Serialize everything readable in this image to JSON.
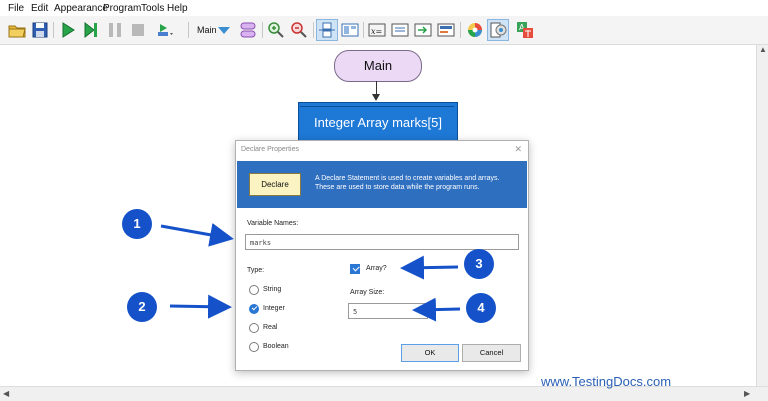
{
  "menu": [
    "File",
    "Edit",
    "Appearance",
    "Program",
    "Tools",
    "Help"
  ],
  "toolbar": {
    "function_label": "Main",
    "icons": [
      "open-folder-icon",
      "save-icon",
      "run-icon",
      "step-icon",
      "pause-icon",
      "stop-icon",
      "speed-icon",
      "dropdown-icon",
      "function-icon",
      "zoom-in-icon",
      "zoom-out-icon",
      "variables-icon",
      "watch-icon",
      "declare-icon",
      "assign-icon",
      "input-icon",
      "output-icon",
      "color-icon",
      "layout-icon",
      "language-icon"
    ]
  },
  "flowchart": {
    "start_label": "Main",
    "declare_label": "Integer Array marks[5]"
  },
  "dialog": {
    "title": "Declare Properties",
    "close_glyph": "✕",
    "banner_shape_label": "Declare",
    "banner_text": "A Declare Statement is used to create variables and arrays. These are used to store data while the program runs.",
    "variable_names_label": "Variable Names:",
    "variable_names_value": "marks",
    "type_label": "Type:",
    "types": [
      {
        "label": "String",
        "selected": false
      },
      {
        "label": "Integer",
        "selected": true
      },
      {
        "label": "Real",
        "selected": false
      },
      {
        "label": "Boolean",
        "selected": false
      }
    ],
    "array_label": "Array?",
    "array_checked": true,
    "array_size_label": "Array Size:",
    "array_size_value": "5",
    "ok_label": "OK",
    "cancel_label": "Cancel"
  },
  "callouts": [
    "1",
    "2",
    "3",
    "4"
  ],
  "watermark": "www.TestingDocs.com",
  "colors": {
    "callout": "#1552c9",
    "banner": "#2f6fc0",
    "declare_block": "#1e78d6",
    "start_terminal": "#ecd9f5"
  }
}
